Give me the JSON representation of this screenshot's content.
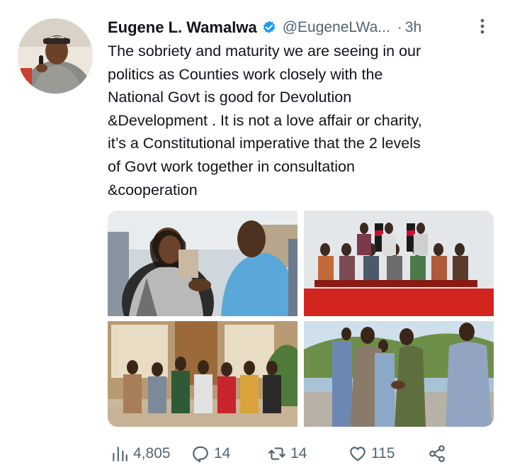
{
  "author": {
    "name": "Eugene L. Wamalwa",
    "handle": "@EugeneLWa...",
    "separator": "·",
    "time": "3h"
  },
  "tweet": {
    "lines": [
      "The sobriety and maturity we are seeing in our",
      "politics as Counties work closely with the",
      "National Govt is good for Devolution",
      "&Development . It is not a love affair or charity,",
      "it’s a Constitutional imperative that the 2 levels",
      "of Govt work together in consultation",
      "&cooperation"
    ]
  },
  "metrics": {
    "views": "4,805",
    "replies": "14",
    "retweets": "14",
    "likes": "115"
  },
  "icons": {
    "verified": "verified-badge-icon",
    "more": "more-vertical-icon",
    "views": "analytics-icon",
    "reply": "reply-icon",
    "retweet": "retweet-icon",
    "like": "heart-icon",
    "share": "share-icon"
  },
  "colors": {
    "verified_blue": "#1d9bf0",
    "text_primary": "#0f1419",
    "text_secondary": "#536471"
  }
}
